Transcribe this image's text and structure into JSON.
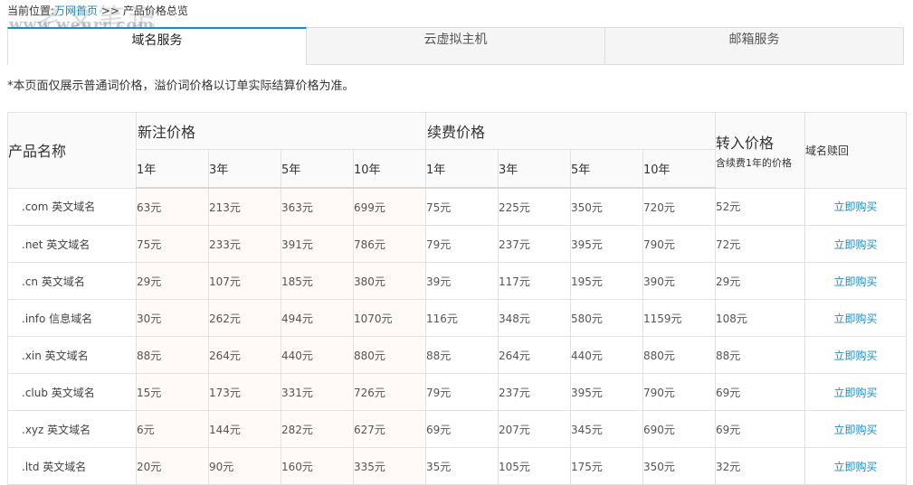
{
  "breadcrumb": {
    "prefix": "当前位置:",
    "home": "万网首页",
    "sep": " >> ",
    "current": "产品价格总览"
  },
  "watermark": {
    "cn": "老文笔记",
    "url": "www.wenrr.com"
  },
  "tabs": [
    {
      "label": "域名服务",
      "active": true
    },
    {
      "label": "云虚拟主机",
      "active": false
    },
    {
      "label": "邮箱服务",
      "active": false
    }
  ],
  "note": "*本页面仅展示普通词价格，溢价词价格以订单实际结算价格为准。",
  "table": {
    "name_header": "产品名称",
    "register_header": "新注价格",
    "renew_header": "续费价格",
    "transfer_header": "转入价格",
    "transfer_sub": "含续费1年的价格",
    "redeem_header": "域名赎回",
    "periods": [
      "1年",
      "3年",
      "5年",
      "10年"
    ],
    "buy_label": "立即购买",
    "rows": [
      {
        "name": ".com 英文域名",
        "reg": [
          "63元",
          "213元",
          "363元",
          "699元"
        ],
        "renew": [
          "75元",
          "225元",
          "350元",
          "720元"
        ],
        "transfer": "52元"
      },
      {
        "name": ".net 英文域名",
        "reg": [
          "75元",
          "233元",
          "391元",
          "786元"
        ],
        "renew": [
          "79元",
          "237元",
          "395元",
          "790元"
        ],
        "transfer": "72元"
      },
      {
        "name": ".cn 英文域名",
        "reg": [
          "29元",
          "107元",
          "185元",
          "380元"
        ],
        "renew": [
          "39元",
          "117元",
          "195元",
          "390元"
        ],
        "transfer": "29元"
      },
      {
        "name": ".info 信息域名",
        "reg": [
          "30元",
          "262元",
          "494元",
          "1070元"
        ],
        "renew": [
          "116元",
          "348元",
          "580元",
          "1159元"
        ],
        "transfer": "108元"
      },
      {
        "name": ".xin 英文域名",
        "reg": [
          "88元",
          "264元",
          "440元",
          "880元"
        ],
        "renew": [
          "88元",
          "264元",
          "440元",
          "880元"
        ],
        "transfer": "88元"
      },
      {
        "name": ".club 英文域名",
        "reg": [
          "15元",
          "173元",
          "331元",
          "726元"
        ],
        "renew": [
          "79元",
          "237元",
          "395元",
          "790元"
        ],
        "transfer": "69元"
      },
      {
        "name": ".xyz 英文域名",
        "reg": [
          "6元",
          "144元",
          "282元",
          "627元"
        ],
        "renew": [
          "69元",
          "207元",
          "345元",
          "690元"
        ],
        "transfer": "69元"
      },
      {
        "name": ".ltd 英文域名",
        "reg": [
          "20元",
          "90元",
          "160元",
          "335元"
        ],
        "renew": [
          "35元",
          "105元",
          "175元",
          "350元"
        ],
        "transfer": "32元"
      }
    ]
  }
}
